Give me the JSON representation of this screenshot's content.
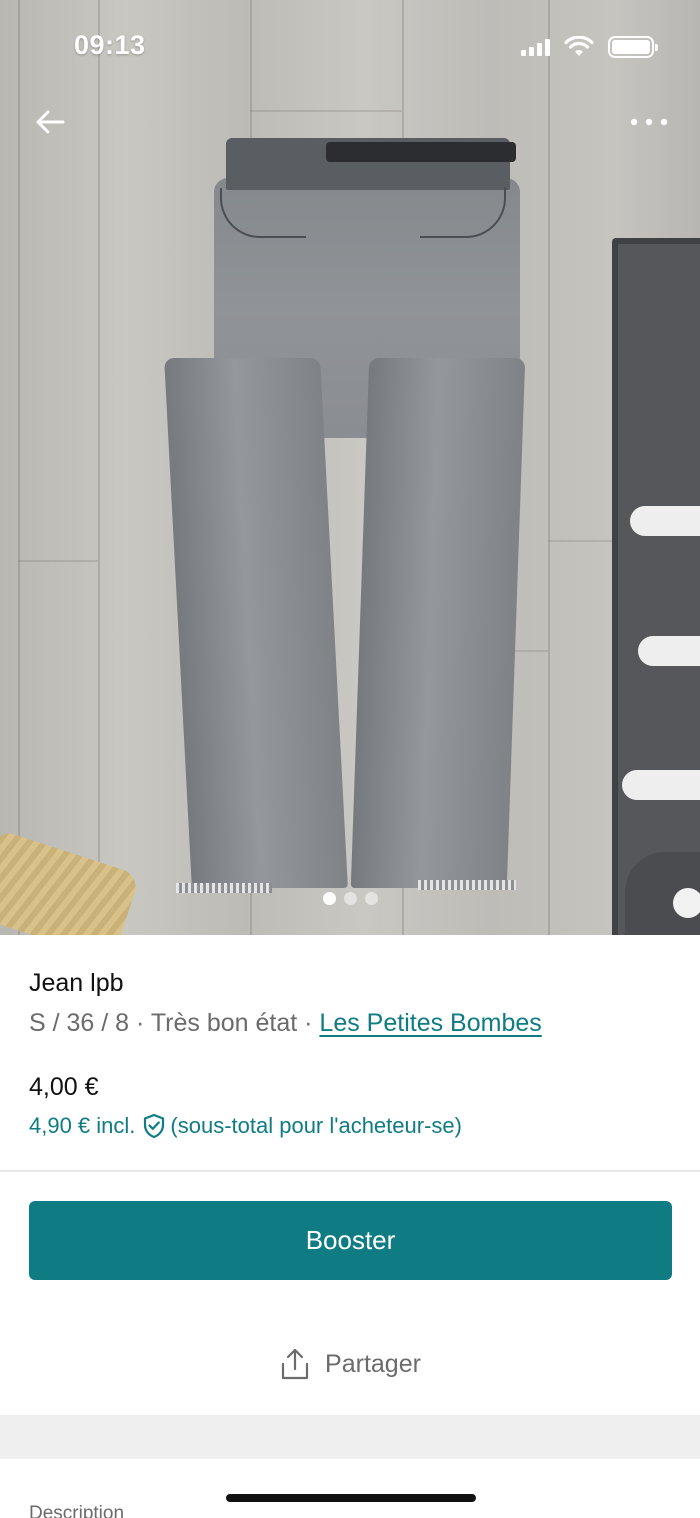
{
  "status_bar": {
    "time": "09:13"
  },
  "gallery": {
    "image_subject": "grey skinny jeans laid flat on wood floor",
    "page_count": 3,
    "active_page": 1
  },
  "item": {
    "title": "Jean lpb",
    "size": "S / 36 / 8",
    "separator": " · ",
    "condition": "Très bon état",
    "brand": "Les Petites Bombes",
    "price": "4,00 €",
    "price_incl": "4,90 € incl.",
    "price_incl_note": "(sous-total pour l'acheteur-se)"
  },
  "actions": {
    "booster_label": "Booster",
    "share_label": "Partager"
  },
  "section": {
    "description_label": "Description"
  },
  "colors": {
    "accent": "#0f7c84",
    "muted_text": "#6b6b6b"
  },
  "icons": [
    "back-arrow-icon",
    "more-dots-icon",
    "signal-icon",
    "wifi-icon",
    "battery-icon",
    "shield-check-icon",
    "share-icon"
  ]
}
